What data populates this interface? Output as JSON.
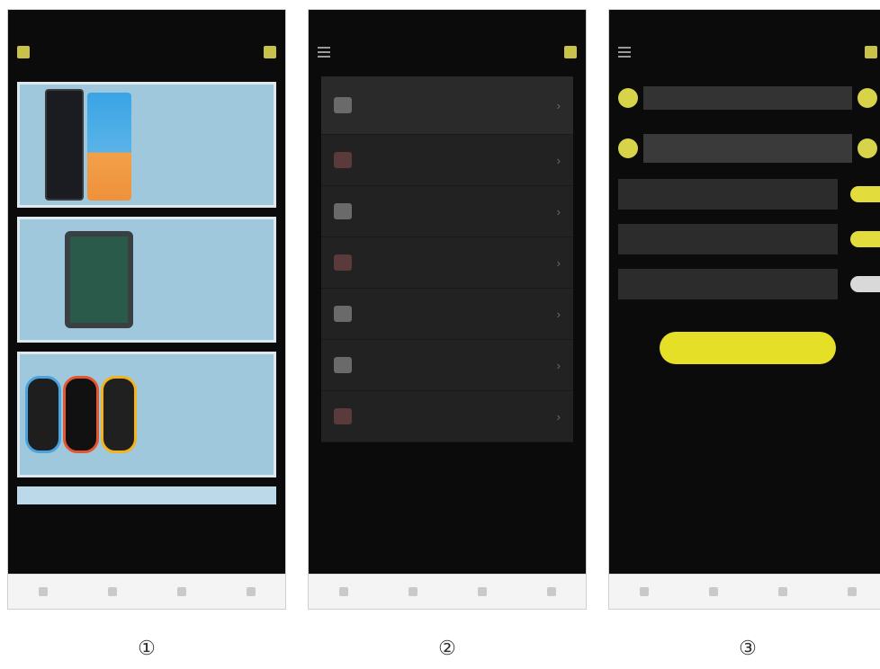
{
  "labels": [
    "①",
    "②",
    "③"
  ],
  "colors": {
    "accent_yellow": "#e6df28",
    "card_blue": "#9fc8dd",
    "screen_bg": "#0b0b0b",
    "nav_bg": "#f4f4f4"
  },
  "phone1": {
    "icons": [
      "app-icon",
      "cart-icon"
    ],
    "cards": [
      {
        "thumb": "phones-image"
      },
      {
        "thumb": "tablet-image"
      },
      {
        "thumb": "watches-image"
      }
    ]
  },
  "phone2": {
    "icons": [
      "menu-icon",
      "cart-icon"
    ],
    "items": [
      {
        "icon": "user-icon"
      },
      {
        "icon": "orders-icon"
      },
      {
        "icon": "coupon-icon"
      },
      {
        "icon": "address-icon"
      },
      {
        "icon": "settings-icon"
      },
      {
        "icon": "service-icon"
      },
      {
        "icon": "logout-icon"
      }
    ]
  },
  "phone3": {
    "icons": [
      "menu-icon",
      "cart-icon"
    ],
    "toggles": [
      true,
      true,
      false
    ]
  }
}
